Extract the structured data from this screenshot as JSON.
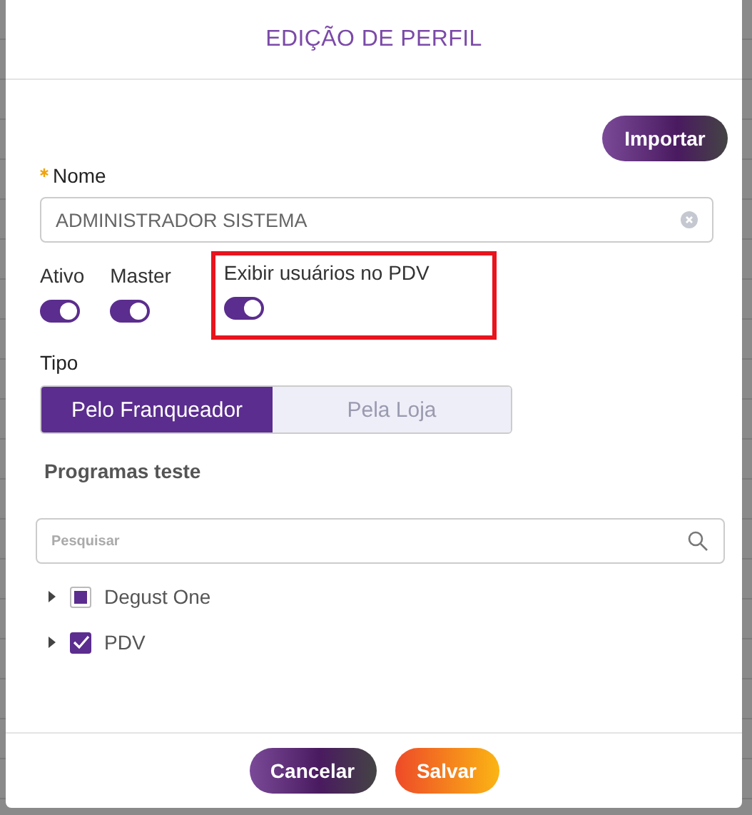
{
  "dialog": {
    "title": "EDIÇÃO DE PERFIL"
  },
  "import_button": "Importar",
  "name_field": {
    "label": "Nome",
    "required": true,
    "value": "ADMINISTRADOR SISTEMA"
  },
  "toggles": [
    {
      "label": "Ativo",
      "on": true,
      "highlighted": false
    },
    {
      "label": "Master",
      "on": true,
      "highlighted": false
    },
    {
      "label": "Exibir usuários no PDV",
      "on": true,
      "highlighted": true
    }
  ],
  "type": {
    "label": "Tipo",
    "options": [
      {
        "label": "Pelo Franqueador",
        "selected": true
      },
      {
        "label": "Pela Loja",
        "selected": false
      }
    ]
  },
  "programs": {
    "title": "Programas teste",
    "search": {
      "placeholder": "Pesquisar"
    },
    "items": [
      {
        "label": "Degust One",
        "expanded": false,
        "checked": false,
        "indeterminate": true
      },
      {
        "label": "PDV",
        "expanded": false,
        "checked": true,
        "indeterminate": false
      }
    ]
  },
  "buttons": [
    {
      "label": "Cancelar",
      "kind": "secondary"
    },
    {
      "label": "Salvar",
      "kind": "primary"
    }
  ]
}
